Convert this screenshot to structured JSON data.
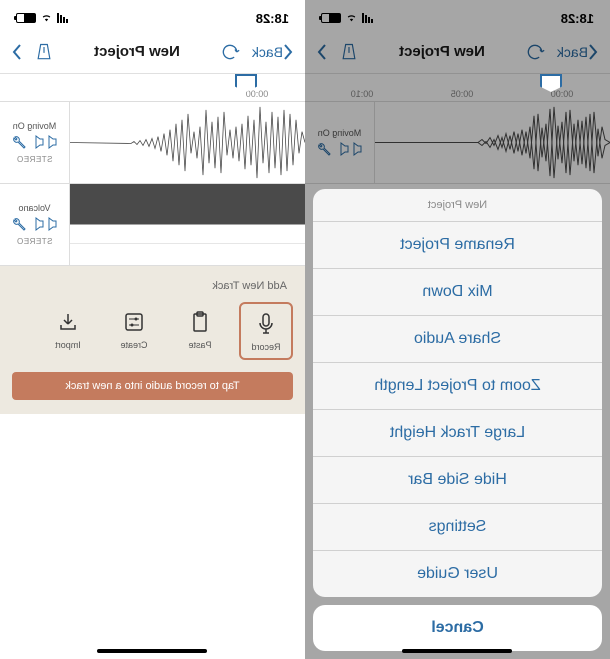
{
  "status": {
    "time": "18:28"
  },
  "nav": {
    "back": "Back",
    "title": "New Project"
  },
  "ruler": {
    "t0": "00:00",
    "t1": "00:05",
    "t2": "00:10"
  },
  "tracks": [
    {
      "name": "Moving On",
      "mode": "STEREO"
    },
    {
      "name": "Volcano",
      "mode": "STEREO"
    }
  ],
  "addPanel": {
    "title": "Add New Track",
    "record": "Record",
    "paste": "Paste",
    "create": "Create",
    "import": "Import",
    "tip": "Tap to record audio into a new track"
  },
  "sheet": {
    "header": "New Project",
    "items": [
      "Rename Project",
      "Mix Down",
      "Share Audio",
      "Zoom to Project Length",
      "Large Track Height",
      "Hide Side Bar",
      "Settings",
      "User Guide"
    ],
    "cancel": "Cancel"
  }
}
